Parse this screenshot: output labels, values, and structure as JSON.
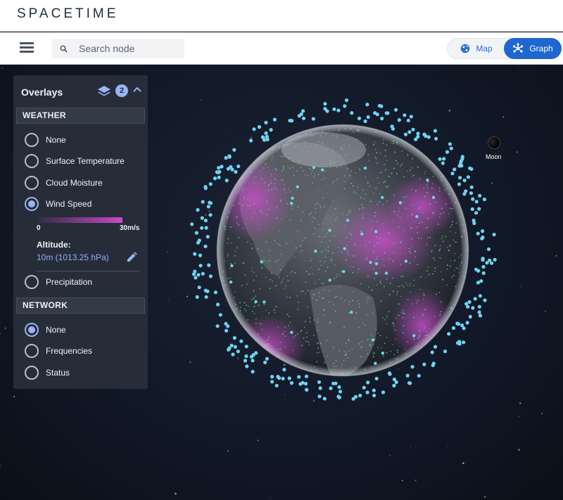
{
  "brand": "SPACETIME",
  "toolbar": {
    "menu_icon": "hamburger-menu-icon",
    "search_icon": "search-icon",
    "search_placeholder": "Search node",
    "map_label": "Map",
    "map_icon": "globe-icon",
    "graph_label": "Graph",
    "graph_icon": "graph-nodes-icon",
    "active_view": "Graph"
  },
  "overlays": {
    "title": "Overlays",
    "layers_icon": "layers-icon",
    "badge_count": "2",
    "collapse_icon": "chevron-up-icon",
    "weather": {
      "heading": "WEATHER",
      "options": [
        {
          "label": "None",
          "selected": false
        },
        {
          "label": "Surface Temperature",
          "selected": false
        },
        {
          "label": "Cloud Moisture",
          "selected": false
        },
        {
          "label": "Wind Speed",
          "selected": true
        }
      ],
      "scale_min": "0",
      "scale_max": "30m/s",
      "scale_color": "#c94acb",
      "altitude_label": "Altitude:",
      "altitude_value": "10m (1013.25 hPa)",
      "edit_icon": "pencil-icon",
      "extra_option": {
        "label": "Precipitation",
        "selected": false
      }
    },
    "network": {
      "heading": "NETWORK",
      "options": [
        {
          "label": "None",
          "selected": true
        },
        {
          "label": "Frequencies",
          "selected": false
        },
        {
          "label": "Status",
          "selected": false
        }
      ]
    }
  },
  "scene": {
    "moon_label": "Moon",
    "satellite_color": "#6fd3f0",
    "node_color": "#63d79a",
    "wind_color": "#b24ab6"
  },
  "colors": {
    "accent": "#1f66d1",
    "selection": "#9bb3ef",
    "panel": "#262d39"
  }
}
